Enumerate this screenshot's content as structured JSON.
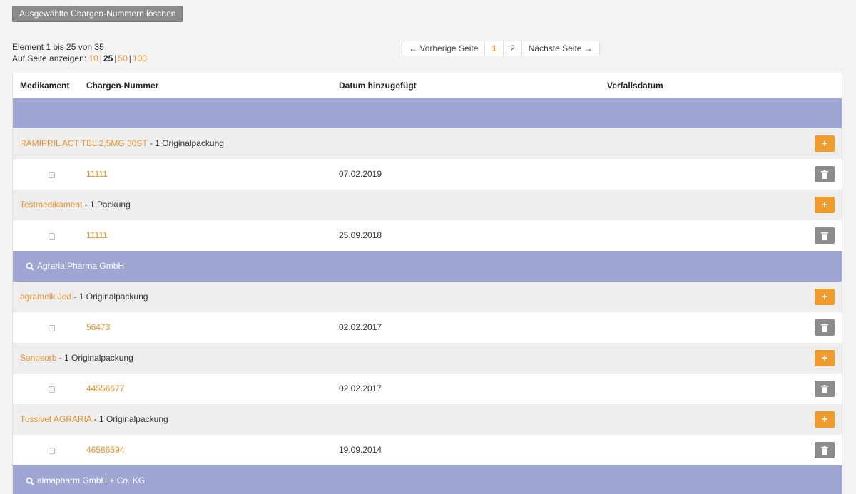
{
  "toolbar": {
    "delete_selected_label": "Ausgewählte Chargen-Nummern löschen"
  },
  "info": {
    "range_text": "Element 1 bis 25 von 35",
    "per_page_label": "Auf Seite anzeigen:",
    "per_page_options": [
      "10",
      "25",
      "50",
      "100"
    ],
    "per_page_selected": "25"
  },
  "pagination": {
    "prev_label": "← Vorherige Seite",
    "pages": [
      "1",
      "2"
    ],
    "current_page": "1",
    "next_label": "Nächste Seite →"
  },
  "table": {
    "headers": {
      "medication": "Medikament",
      "batch_number": "Chargen-Nummer",
      "date_added": "Datum hinzugefügt",
      "expiry_date": "Verfallsdatum"
    },
    "groups": [
      {
        "manufacturer": "",
        "medications": [
          {
            "name": "RAMIPRIL ACT TBL 2,5MG 30ST",
            "suffix": "- 1 Originalpackung",
            "batches": [
              {
                "number": "11111",
                "date": "07.02.2019",
                "expiry": ""
              }
            ]
          },
          {
            "name": "Testmedikament",
            "suffix": "- 1 Packung",
            "batches": [
              {
                "number": "11111",
                "date": "25.09.2018",
                "expiry": ""
              }
            ]
          }
        ]
      },
      {
        "manufacturer": "Agraria Pharma GmbH",
        "medications": [
          {
            "name": "agramelk Jod",
            "suffix": "- 1 Originalpackung",
            "batches": [
              {
                "number": "56473",
                "date": "02.02.2017",
                "expiry": ""
              }
            ]
          },
          {
            "name": "Sanosorb",
            "suffix": "- 1 Originalpackung",
            "batches": [
              {
                "number": "44556677",
                "date": "02.02.2017",
                "expiry": ""
              }
            ]
          },
          {
            "name": "Tussivet AGRARIA",
            "suffix": "- 1 Originalpackung",
            "batches": [
              {
                "number": "46586594",
                "date": "19.09.2014",
                "expiry": ""
              }
            ]
          }
        ]
      },
      {
        "manufacturer": "almapharm GmbH + Co. KG",
        "medications": []
      }
    ]
  },
  "colors": {
    "accent": "#e8922b",
    "group_header": "#9fa6d4",
    "medication_row": "#eeeeee",
    "delete_button": "#8c8c8c",
    "add_button": "#f09c2d"
  },
  "icons": {
    "search": "search-icon",
    "add": "plus-icon",
    "delete": "trash-icon"
  }
}
